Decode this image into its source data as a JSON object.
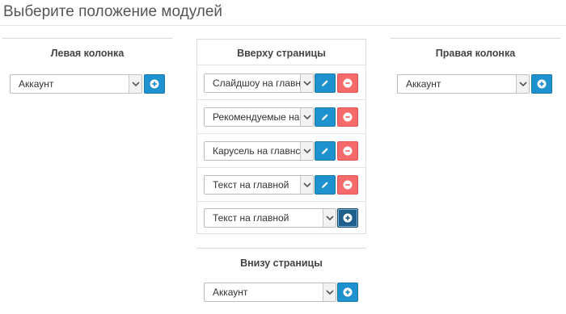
{
  "page": {
    "title": "Выберите положение модулей"
  },
  "left_column": {
    "heading": "Левая колонка",
    "select_value": "Аккаунт"
  },
  "top_of_page": {
    "heading": "Вверху страницы",
    "rows": [
      {
        "select_value": "Слайдшоу на главн"
      },
      {
        "select_value": "Рекомендуемые на"
      },
      {
        "select_value": "Карусель на главнс"
      },
      {
        "select_value": "Текст на главной"
      }
    ],
    "add_row": {
      "select_value": "Текст на главной"
    }
  },
  "right_column": {
    "heading": "Правая колонка",
    "select_value": "Аккаунт"
  },
  "bottom_of_page": {
    "heading": "Внизу страницы",
    "select_value": "Аккаунт"
  },
  "icons": {
    "add": "plus-circle-icon",
    "edit": "pencil-icon",
    "remove": "minus-circle-icon",
    "dropdown": "chevron-down-icon"
  },
  "colors": {
    "blue": "#1e91cf",
    "red": "#f56b6b",
    "focused_dark_blue": "#1f5f8b"
  }
}
